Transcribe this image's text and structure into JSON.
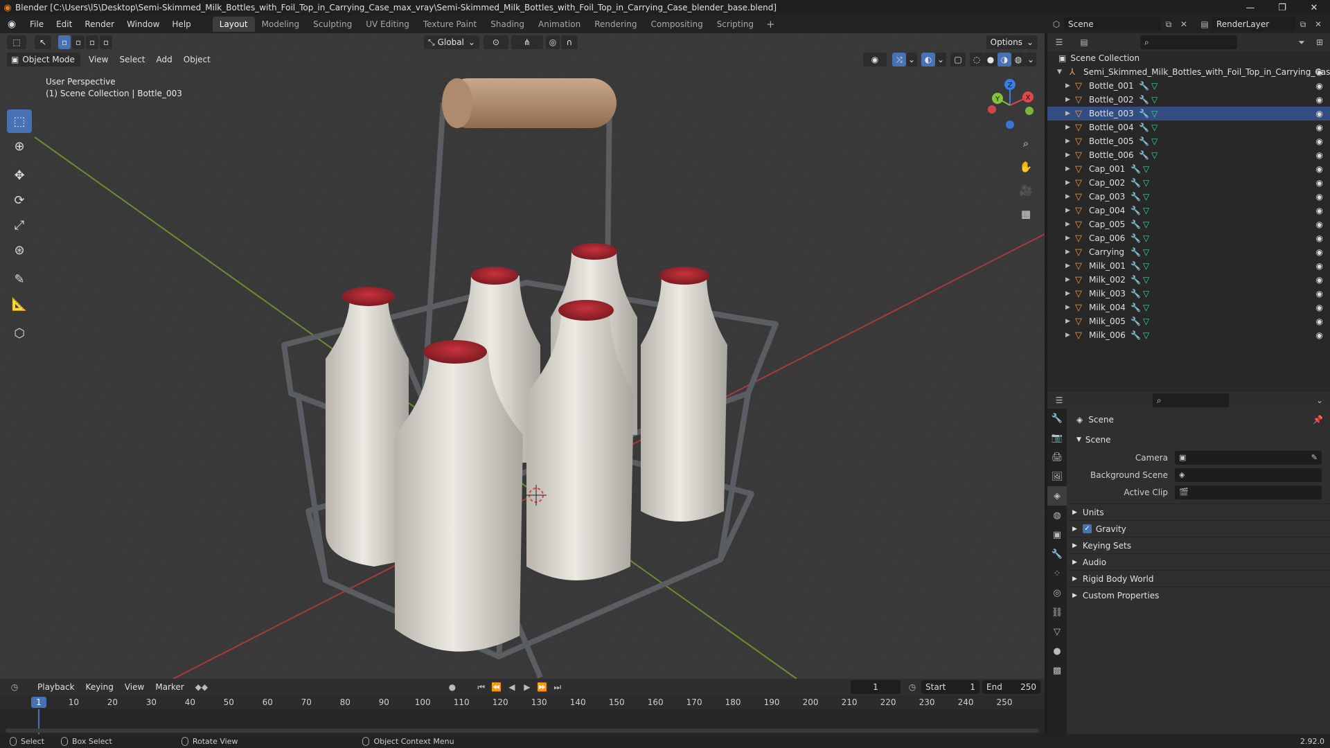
{
  "window": {
    "title": "Blender [C:\\Users\\l5\\Desktop\\Semi-Skimmed_Milk_Bottles_with_Foil_Top_in_Carrying_Case_max_vray\\Semi-Skimmed_Milk_Bottles_with_Foil_Top_in_Carrying_Case_blender_base.blend]"
  },
  "menu": [
    "File",
    "Edit",
    "Render",
    "Window",
    "Help"
  ],
  "workspaces": [
    "Layout",
    "Modeling",
    "Sculpting",
    "UV Editing",
    "Texture Paint",
    "Shading",
    "Animation",
    "Rendering",
    "Compositing",
    "Scripting"
  ],
  "scene_field": "Scene",
  "renderlayer_field": "RenderLayer",
  "viewport": {
    "mode": "Object Mode",
    "menus": [
      "View",
      "Select",
      "Add",
      "Object"
    ],
    "transform_orientation": "Global",
    "options_label": "Options",
    "overlay_line1": "User Perspective",
    "overlay_line2": "(1) Scene Collection | Bottle_003",
    "gizmo_labels": {
      "x": "X",
      "y": "Y",
      "z": "Z"
    }
  },
  "outliner": {
    "root": "Scene Collection",
    "collection": "Semi_Skimmed_Milk_Bottles_with_Foil_Top_in_Carrying_Cas",
    "objects": [
      "Bottle_001",
      "Bottle_002",
      "Bottle_003",
      "Bottle_004",
      "Bottle_005",
      "Bottle_006",
      "Cap_001",
      "Cap_002",
      "Cap_003",
      "Cap_004",
      "Cap_005",
      "Cap_006",
      "Carrying",
      "Milk_001",
      "Milk_002",
      "Milk_003",
      "Milk_004",
      "Milk_005",
      "Milk_006"
    ],
    "selected": "Bottle_003"
  },
  "properties": {
    "context": "Scene",
    "panel": "Scene",
    "rows": [
      {
        "label": "Camera",
        "value": ""
      },
      {
        "label": "Background Scene",
        "value": ""
      },
      {
        "label": "Active Clip",
        "value": ""
      }
    ],
    "subpanels": [
      "Units",
      "Gravity",
      "Keying Sets",
      "Audio",
      "Rigid Body World",
      "Custom Properties"
    ],
    "gravity_checked": true
  },
  "timeline": {
    "menus": [
      "Playback",
      "Keying",
      "View",
      "Marker"
    ],
    "current_frame": "1",
    "start_label": "Start",
    "start": "1",
    "end_label": "End",
    "end": "250",
    "ruler": [
      "10",
      "20",
      "30",
      "40",
      "50",
      "60",
      "70",
      "80",
      "90",
      "100",
      "110",
      "120",
      "130",
      "140",
      "150",
      "160",
      "170",
      "180",
      "190",
      "200",
      "210",
      "220",
      "230",
      "240",
      "250"
    ],
    "playhead": "1"
  },
  "statusbar": {
    "select": "Select",
    "box_select": "Box Select",
    "rotate_view": "Rotate View",
    "context_menu": "Object Context Menu",
    "version": "2.92.0"
  },
  "colors": {
    "accent": "#4772b3",
    "x_axis": "#e0474c",
    "y_axis": "#85c23a",
    "z_axis": "#3b7de0",
    "object_icon": "#e89a4a",
    "mesh_icon": "#3fd39a"
  }
}
